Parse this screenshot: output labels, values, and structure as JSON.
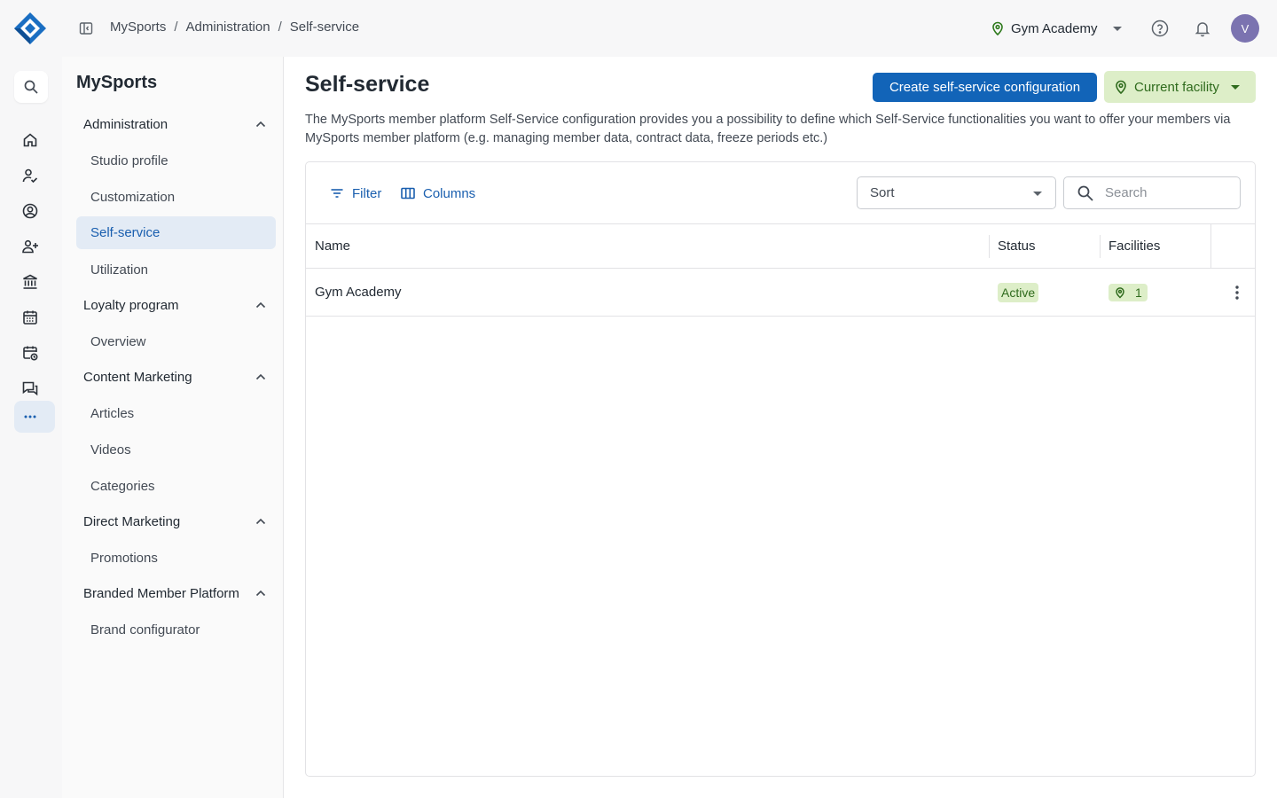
{
  "header": {
    "breadcrumb": [
      "MySports",
      "Administration",
      "Self-service"
    ],
    "facility": "Gym Academy",
    "avatar_initial": "V"
  },
  "rail": {
    "items": [
      "search-icon",
      "home-icon",
      "member-check-icon",
      "account-circle-icon",
      "add-members-icon",
      "bank-icon",
      "calendar-icon",
      "calendar-clock-icon",
      "chat-icon",
      "more-icon"
    ],
    "active": "more-icon"
  },
  "sidebar": {
    "title": "MySports",
    "groups": [
      {
        "label": "Administration",
        "items": [
          "Studio profile",
          "Customization",
          "Self-service",
          "Utilization"
        ]
      },
      {
        "label": "Loyalty program",
        "items": [
          "Overview"
        ]
      },
      {
        "label": "Content Marketing",
        "items": [
          "Articles",
          "Videos",
          "Categories"
        ]
      },
      {
        "label": "Direct Marketing",
        "items": [
          "Promotions"
        ]
      },
      {
        "label": "Branded Member Platform",
        "items": [
          "Brand configurator"
        ]
      }
    ],
    "active_item": "Self-service"
  },
  "main": {
    "title": "Self-service",
    "create_button": "Create self-service configuration",
    "facility_button": "Current facility",
    "description": "The MySports member platform Self-Service configuration provides you a possibility to define which Self-Service functionalities you want to offer your members via MySports member platform (e.g. managing member data, contract data, freeze periods etc.)",
    "toolbar": {
      "filter": "Filter",
      "columns": "Columns",
      "sort_placeholder": "Sort",
      "search_placeholder": "Search"
    },
    "table": {
      "columns": [
        "Name",
        "Status",
        "Facilities"
      ],
      "rows": [
        {
          "name": "Gym Academy",
          "status": "Active",
          "facilities": "1"
        }
      ]
    }
  },
  "colors": {
    "primary": "#1264b8",
    "success_bg": "#ddeec8",
    "success_text": "#2f6b1d",
    "avatar": "#7b73b0"
  }
}
